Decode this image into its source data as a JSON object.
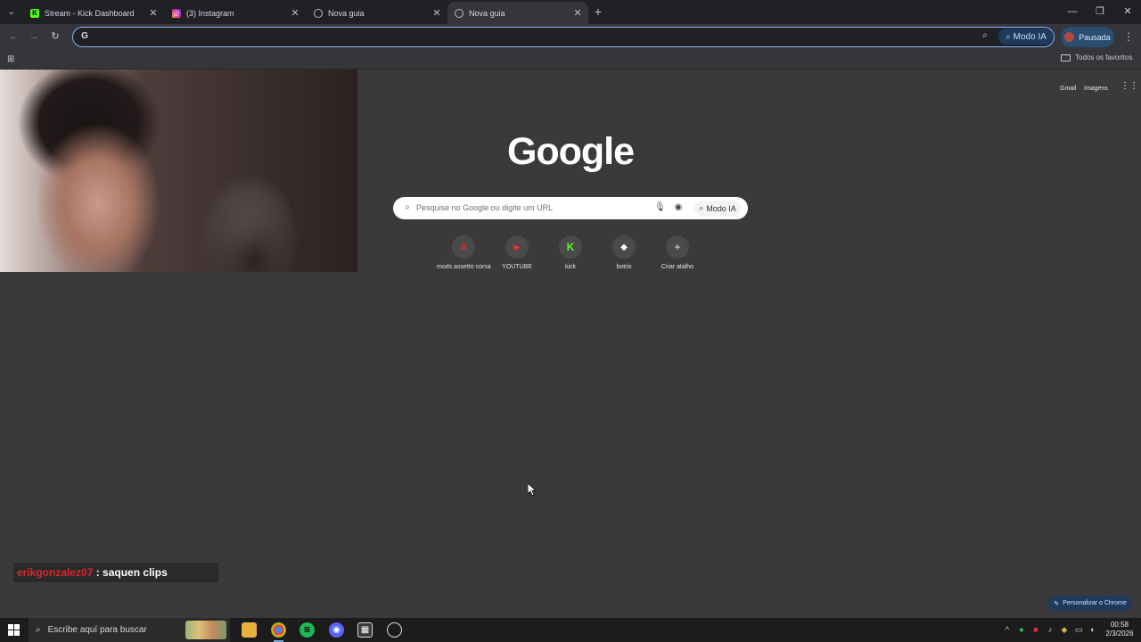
{
  "tabs": [
    {
      "title": "Stream - Kick Dashboard",
      "favicon": "kick-icon",
      "active": false
    },
    {
      "title": "(3) Instagram",
      "favicon": "instagram-icon",
      "active": false
    },
    {
      "title": "Nova guia",
      "favicon": "chrome-icon",
      "active": false
    },
    {
      "title": "Nova guia",
      "favicon": "chrome-icon",
      "active": true
    }
  ],
  "toolbar": {
    "omnibox_value": "",
    "modo_ia_label": "Modo IA",
    "profile_label": "Pausada"
  },
  "bookmarks": {
    "all_favorites_label": "Todos os favoritos"
  },
  "ntp": {
    "gmail_label": "Gmail",
    "images_label": "Imagens",
    "logo_text": "Google",
    "search_placeholder": "Pesquise no Google ou digite um URL",
    "mode_label": "Modo IA",
    "shortcuts": [
      {
        "label": "mods assetto corsa",
        "icon": "assetto-corsa-icon",
        "glyph": "A",
        "color": "#d52b2b"
      },
      {
        "label": "YOUTUBE",
        "icon": "youtube-icon",
        "glyph": "▶",
        "color": "#ff2a2a"
      },
      {
        "label": "kick",
        "icon": "kick-icon",
        "glyph": "K",
        "color": "#53fc18"
      },
      {
        "label": "botrix",
        "icon": "botrix-icon",
        "glyph": "◆",
        "color": "#ffffff"
      },
      {
        "label": "Criar atalho",
        "icon": "plus-icon",
        "glyph": "+",
        "color": "#e8e8e8"
      }
    ],
    "customize_label": "Personalizar o Chrome"
  },
  "chat": {
    "user": "erikgonzalez07",
    "message": ": saquen clips"
  },
  "taskbar": {
    "search_placeholder": "Escribe aquí para buscar",
    "time": "00:58",
    "date": "2/3/2026"
  },
  "colors": {
    "accent": "#8ab4f8",
    "kick_green": "#53fc18",
    "chat_user": "#d4262d"
  }
}
